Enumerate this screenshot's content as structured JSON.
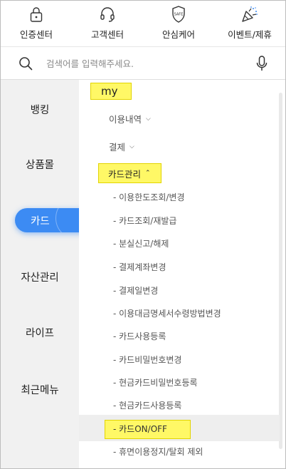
{
  "shortcuts": [
    {
      "label": "인증센터",
      "icon": "lock-icon"
    },
    {
      "label": "고객센터",
      "icon": "headset-icon"
    },
    {
      "label": "안심케어",
      "icon": "shield-safe-icon",
      "badge": "SAFE"
    },
    {
      "label": "이벤트/제휴",
      "icon": "party-popper-icon"
    }
  ],
  "search": {
    "placeholder": "검색어를 입력해주세요."
  },
  "categories": [
    "뱅킹",
    "상품몰",
    "카드",
    "자산관리",
    "라이프",
    "최근메뉴"
  ],
  "active_category": "카드",
  "menu": {
    "section_title": "my",
    "sub1": "이용내역",
    "sub2": "결제",
    "group": "카드관리",
    "items": [
      "- 이용한도조회/변경",
      "- 카드조회/재발급",
      "- 분실신고/해제",
      "- 결제계좌변경",
      "- 결제일변경",
      "- 이용대금명세서수령방법변경",
      "- 카드사용등록",
      "- 카드비밀번호변경",
      "- 현금카드비밀번호등록",
      "- 현금카드사용등록",
      "- 카드ON/OFF",
      "- 휴면이용정지/탈회 제외"
    ]
  },
  "colors": {
    "accent": "#3c8bf3",
    "highlight": "#fff866",
    "sidebar_bg": "#f1f1f1"
  }
}
